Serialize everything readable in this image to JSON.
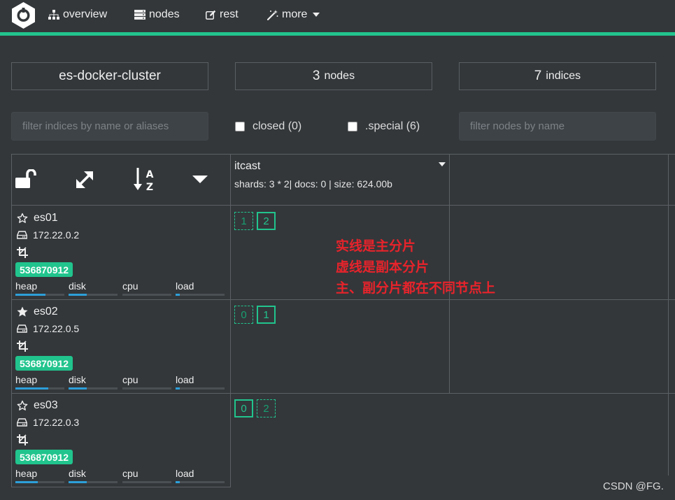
{
  "nav": {
    "overview": "overview",
    "nodes": "nodes",
    "rest": "rest",
    "more": "more"
  },
  "summary": {
    "cluster_name": "es-docker-cluster",
    "nodes_count": "3",
    "nodes_label": "nodes",
    "indices_count": "7",
    "indices_label": "indices"
  },
  "filters": {
    "indices_placeholder": "filter indices by name or aliases",
    "closed_label": "closed (0)",
    "special_label": ".special (6)",
    "nodes_placeholder": "filter nodes by name"
  },
  "index": {
    "name": "itcast",
    "meta": "shards: 3 * 2| docs: 0 | size: 624.00b"
  },
  "metric_labels": [
    "heap",
    "disk",
    "cpu",
    "load"
  ],
  "nodes": [
    {
      "name": "es01",
      "ip": "172.22.0.2",
      "badge": "536870912",
      "master": false,
      "usage": {
        "heap": 0.62,
        "disk": 0.37,
        "cpu": 0.0,
        "load": 0.08
      },
      "shards": [
        {
          "num": "1",
          "type": "replica"
        },
        {
          "num": "2",
          "type": "primary"
        }
      ]
    },
    {
      "name": "es02",
      "ip": "172.22.0.5",
      "badge": "536870912",
      "master": true,
      "usage": {
        "heap": 0.67,
        "disk": 0.37,
        "cpu": 0.0,
        "load": 0.08
      },
      "shards": [
        {
          "num": "0",
          "type": "replica"
        },
        {
          "num": "1",
          "type": "primary"
        }
      ]
    },
    {
      "name": "es03",
      "ip": "172.22.0.3",
      "badge": "536870912",
      "master": false,
      "usage": {
        "heap": 0.45,
        "disk": 0.37,
        "cpu": 0.0,
        "load": 0.08
      },
      "shards": [
        {
          "num": "0",
          "type": "primary"
        },
        {
          "num": "2",
          "type": "replica"
        }
      ]
    }
  ],
  "annotation": {
    "line1": "实线是主分片",
    "line2": "虚线是副本分片",
    "line3": "主、副分片都在不同节点上"
  },
  "watermark": "CSDN @FG.",
  "colors": {
    "background": "#33373a",
    "accent": "#21c48d",
    "bar_fill": "#2d9fd9",
    "annotation": "#e8232b"
  }
}
